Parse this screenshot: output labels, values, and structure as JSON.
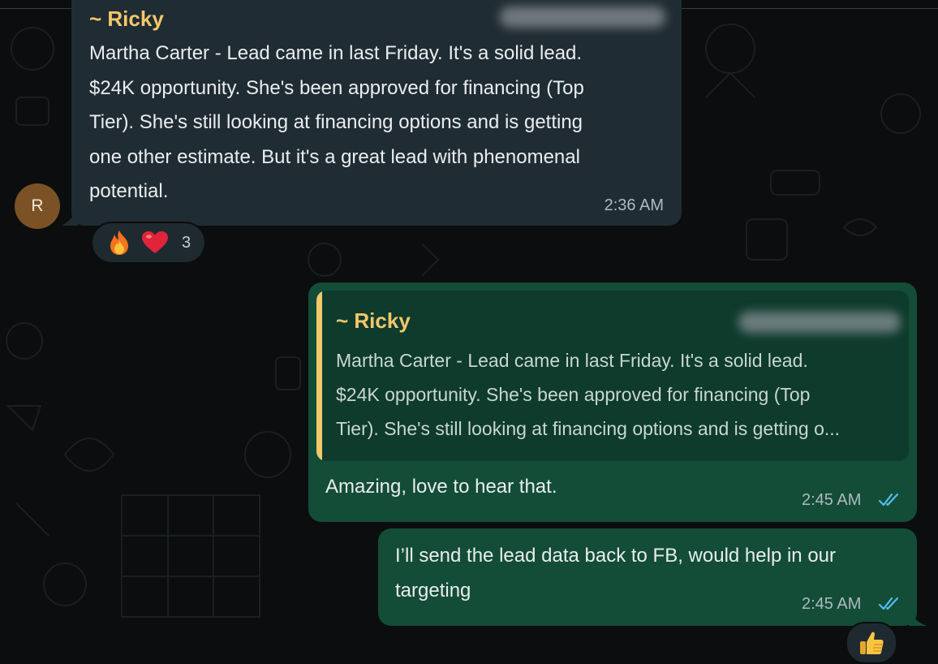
{
  "chat": {
    "incoming": {
      "sender": "~ Ricky",
      "avatar_initial": "R",
      "lines": [
        "Martha Carter - Lead came in last Friday. It's a solid lead.",
        "$24K opportunity. She's been approved for financing (Top",
        "Tier). She's still looking at financing options and is getting",
        "one other estimate. But it's a great lead with phenomenal",
        "potential."
      ],
      "time": "2:36 AM",
      "reactions": {
        "emojis": [
          "fire",
          "red-heart"
        ],
        "count": "3"
      }
    },
    "reply": {
      "quoted_sender": "~ Ricky",
      "quoted_lines": [
        "Martha Carter - Lead came in last Friday. It's a solid lead.",
        "$24K opportunity. She's been approved for financing (Top",
        "Tier). She's still looking at financing options and is getting o..."
      ],
      "text": "Amazing, love to hear that.",
      "time": "2:45 AM",
      "status": "read"
    },
    "second": {
      "lines": [
        "I’ll send the lead data back to FB, would help in our",
        "targeting"
      ],
      "time": "2:45 AM",
      "status": "read",
      "reaction": "thumbs-up"
    }
  },
  "colors": {
    "background": "#0b0d0e",
    "incoming_bubble": "#202c33",
    "outgoing_bubble": "#134d37",
    "quote_block": "#0e3b2c",
    "sender_name": "#f4c76b",
    "read_ticks": "#53bdeb"
  }
}
